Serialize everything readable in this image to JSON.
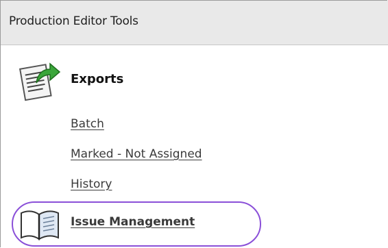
{
  "panel": {
    "title": "Production Editor Tools"
  },
  "exports": {
    "icon": "export-document-icon",
    "title": "Exports",
    "links": [
      {
        "label": "Batch"
      },
      {
        "label": "Marked - Not Assigned"
      },
      {
        "label": "History"
      }
    ]
  },
  "issue_management": {
    "icon": "book-icon",
    "label": "Issue Management",
    "highlight_color": "#8a4fd8"
  },
  "colors": {
    "header_bg": "#e9e9e9",
    "link": "#3a3a3a",
    "arrow_green": "#3aa63a"
  }
}
